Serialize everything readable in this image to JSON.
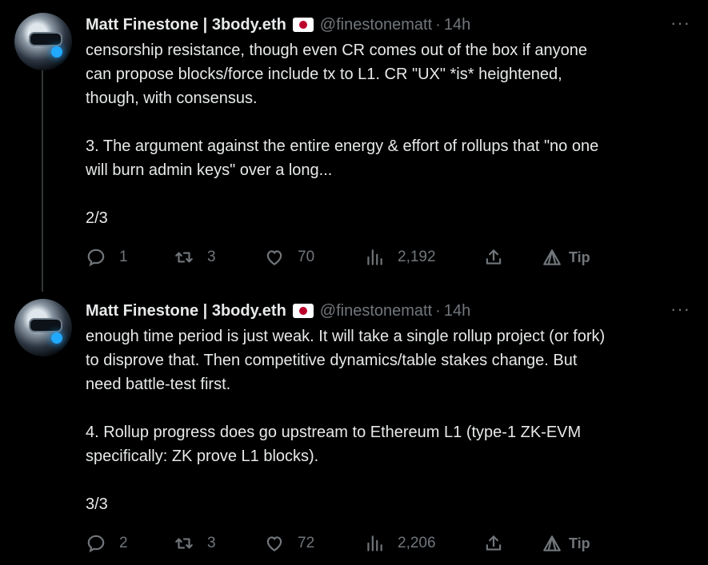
{
  "tweets": [
    {
      "author_name": "Matt Finestone | 3body.eth",
      "handle": "@finestonematt",
      "separator": "·",
      "time": "14h",
      "more": "···",
      "lines": [
        "censorship resistance, though even CR comes out of the box if anyone",
        "can propose blocks/force include tx to L1. CR \"UX\" *is* heightened,",
        "though, with consensus.",
        "",
        "3. The argument against the entire energy & effort of rollups that \"no one",
        "will burn admin keys\" over a long...",
        "",
        "2/3"
      ],
      "replies": "1",
      "retweets": "3",
      "likes": "70",
      "views": "2,192",
      "tip_label": "Tip"
    },
    {
      "author_name": "Matt Finestone | 3body.eth",
      "handle": "@finestonematt",
      "separator": "·",
      "time": "14h",
      "more": "···",
      "lines": [
        "enough time period is just weak. It will take a single rollup project (or fork)",
        "to disprove that. Then competitive dynamics/table stakes change. But",
        "need battle-test first.",
        "",
        "4. Rollup progress does go upstream to Ethereum L1 (type-1 ZK-EVM",
        "specifically: ZK prove L1 blocks).",
        "",
        "3/3"
      ],
      "replies": "2",
      "retweets": "3",
      "likes": "72",
      "views": "2,206",
      "tip_label": "Tip"
    }
  ],
  "colors": {
    "background": "#000000",
    "text": "#e7e9ea",
    "muted": "#71767b",
    "thread_line": "#333639"
  },
  "icons": [
    "reply-icon",
    "retweet-icon",
    "like-icon",
    "views-icon",
    "share-icon",
    "tip-icon",
    "more-icon",
    "japan-flag-icon"
  ]
}
